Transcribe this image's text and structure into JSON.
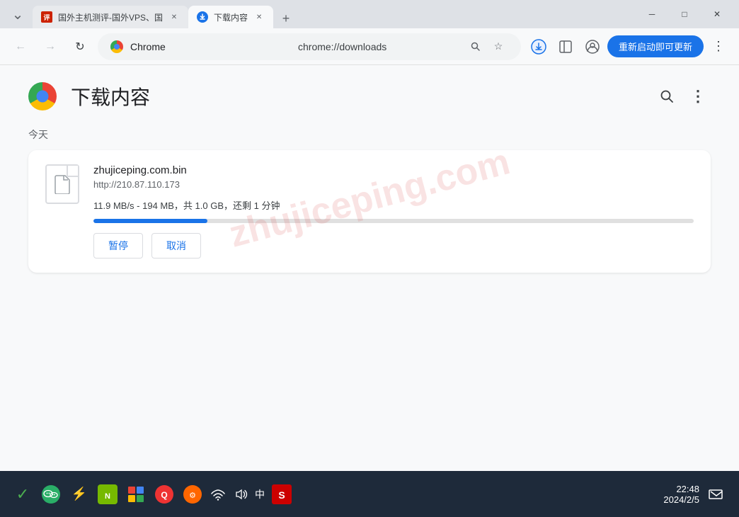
{
  "window": {
    "title": "下载内容",
    "tab1_title": "国外主机测评-国外VPS、国",
    "tab2_title": "下载内容"
  },
  "toolbar": {
    "back_label": "←",
    "forward_label": "→",
    "refresh_label": "↻",
    "chrome_label": "Chrome",
    "address": "chrome://downloads",
    "update_label": "重新启动即可更新",
    "more_label": "⋮"
  },
  "page": {
    "title": "下载内容",
    "search_label": "🔍",
    "more_label": "⋮"
  },
  "downloads": {
    "section_label": "今天",
    "item": {
      "filename": "zhujiceping.com.bin",
      "url": "http://210.87.110.173",
      "status": "11.9 MB/s - 194 MB，共 1.0 GB，还剩 1 分钟",
      "progress_percent": 19,
      "pause_label": "暂停",
      "cancel_label": "取消"
    }
  },
  "watermark": "zhujiceping.com",
  "taskbar": {
    "time": "22:48",
    "date": "2024/2/5",
    "icons": [
      "✓",
      "💬",
      "🔵",
      "🟢",
      "🎮",
      "🐧",
      "⚙",
      "📶",
      "🔊",
      "中",
      "S"
    ]
  }
}
